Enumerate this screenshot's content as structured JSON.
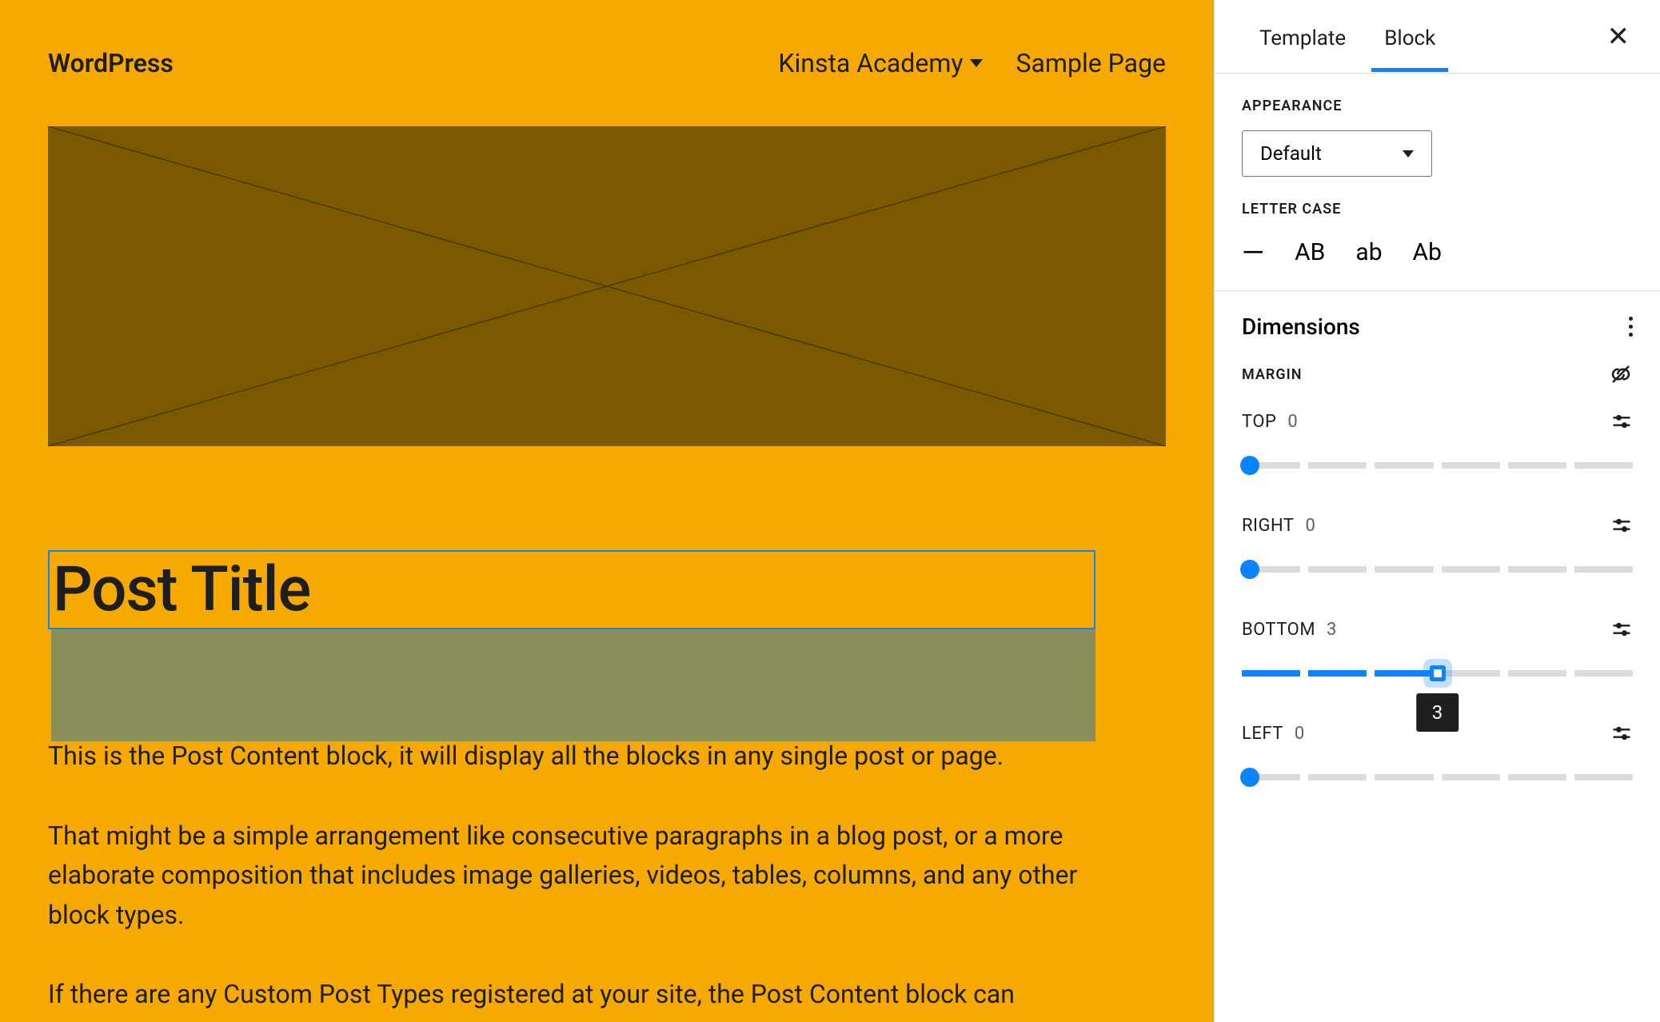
{
  "header": {
    "site_title": "WordPress",
    "nav": [
      {
        "label": "Kinsta Academy",
        "has_submenu": true
      },
      {
        "label": "Sample Page",
        "has_submenu": false
      }
    ]
  },
  "post": {
    "title": "Post Title",
    "paragraphs": [
      "This is the Post Content block, it will display all the blocks in any single post or page.",
      "That might be a simple arrangement like consecutive paragraphs in a blog post, or a more elaborate composition that includes image galleries, videos, tables, columns, and any other block types.",
      "If there are any Custom Post Types registered at your site, the Post Content block can"
    ]
  },
  "sidebar": {
    "tabs": {
      "template": "Template",
      "block": "Block",
      "active": "block"
    },
    "appearance": {
      "label": "APPEARANCE",
      "value": "Default"
    },
    "letter_case": {
      "label": "LETTER CASE",
      "options": [
        "—",
        "AB",
        "ab",
        "Ab"
      ]
    },
    "dimensions": {
      "title": "Dimensions",
      "margin_label": "MARGIN",
      "controls": {
        "top": {
          "label": "TOP",
          "value": 0,
          "segments": 6
        },
        "right": {
          "label": "RIGHT",
          "value": 0,
          "segments": 6
        },
        "bottom": {
          "label": "BOTTOM",
          "value": 3,
          "segments": 6,
          "tooltip": "3"
        },
        "left": {
          "label": "LEFT",
          "value": 0,
          "segments": 6
        }
      }
    }
  },
  "colors": {
    "canvas_bg": "#f6a900",
    "featured_bg": "#7b5900",
    "spacer_bg": "#898e5a",
    "selection": "#0a84ff"
  }
}
